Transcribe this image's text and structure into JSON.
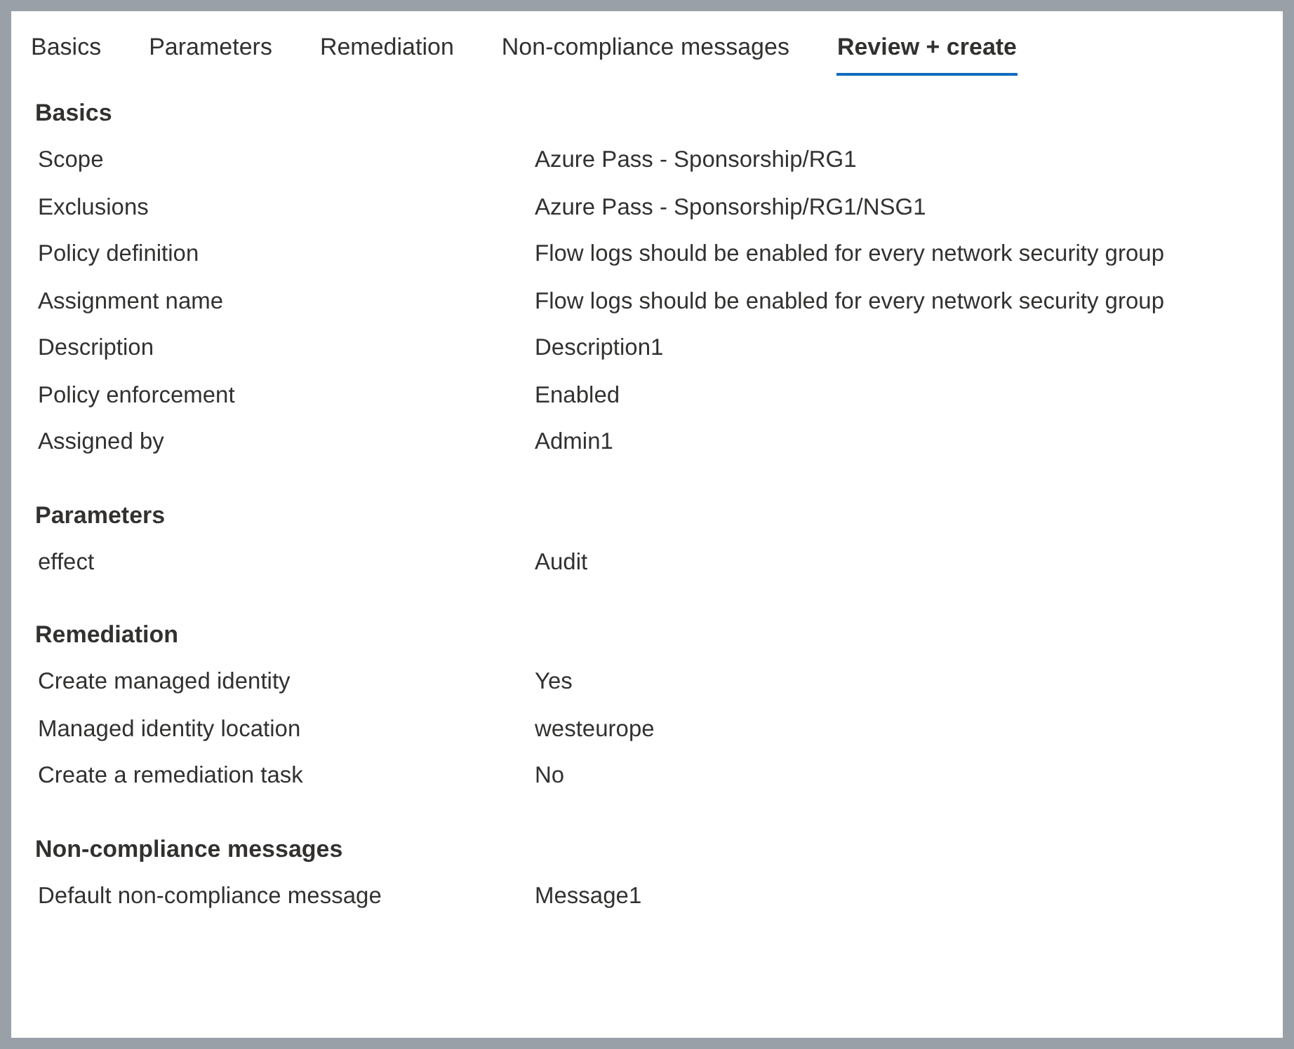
{
  "tabs": [
    {
      "label": "Basics",
      "selected": false
    },
    {
      "label": "Parameters",
      "selected": false
    },
    {
      "label": "Remediation",
      "selected": false
    },
    {
      "label": "Non-compliance messages",
      "selected": false
    },
    {
      "label": "Review + create",
      "selected": true
    }
  ],
  "sections": [
    {
      "title": "Basics",
      "rows": [
        {
          "label": "Scope",
          "value": "Azure Pass - Sponsorship/RG1"
        },
        {
          "label": "Exclusions",
          "value": "Azure Pass - Sponsorship/RG1/NSG1"
        },
        {
          "label": "Policy definition",
          "value": "Flow logs should be enabled for every network security group"
        },
        {
          "label": "Assignment name",
          "value": "Flow logs should be enabled for every network security group"
        },
        {
          "label": "Description",
          "value": "Description1"
        },
        {
          "label": "Policy enforcement",
          "value": "Enabled"
        },
        {
          "label": "Assigned by",
          "value": "Admin1"
        }
      ]
    },
    {
      "title": "Parameters",
      "rows": [
        {
          "label": "effect",
          "value": "Audit"
        }
      ]
    },
    {
      "title": "Remediation",
      "rows": [
        {
          "label": "Create managed identity",
          "value": "Yes"
        },
        {
          "label": "Managed identity location",
          "value": "westeurope"
        },
        {
          "label": "Create a remediation task",
          "value": "No"
        }
      ]
    },
    {
      "title": "Non-compliance messages",
      "rows": [
        {
          "label": "Default non-compliance message",
          "value": "Message1"
        }
      ]
    }
  ]
}
